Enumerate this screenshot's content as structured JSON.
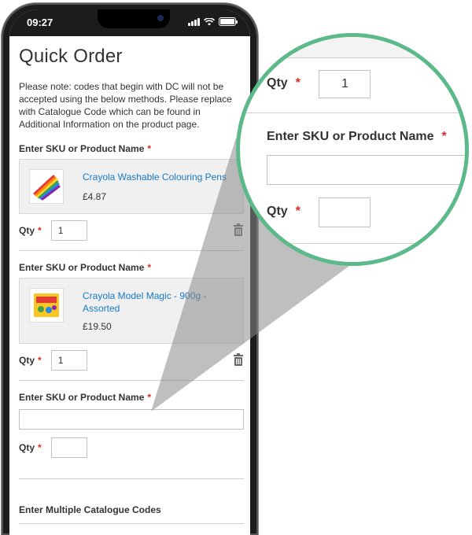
{
  "status_bar": {
    "time": "09:27"
  },
  "page": {
    "title": "Quick Order",
    "note": "Please note: codes that begin with DC will not be accepted using the below methods. Please replace with Catalogue Code which can be found in Additional Information on the product page."
  },
  "rows": [
    {
      "label": "Enter SKU or Product Name",
      "required": "*",
      "product_name": "Crayola Washable Colouring Pens",
      "price": "£4.87",
      "qty_label": "Qty",
      "qty_value": "1"
    },
    {
      "label": "Enter SKU or Product Name",
      "required": "*",
      "product_name": "Crayola Model Magic - 900g - Assorted",
      "price": "£19.50",
      "qty_label": "Qty",
      "qty_value": "1"
    },
    {
      "label": "Enter SKU or Product Name",
      "required": "*",
      "sku_value": "",
      "qty_label": "Qty",
      "qty_value": ""
    }
  ],
  "multiple_codes": {
    "label": "Enter Multiple Catalogue Codes"
  },
  "zoom": {
    "qty_label": "Qty",
    "qty_value": "1",
    "required": "*",
    "sku_label": "Enter SKU or Product Name",
    "sku_value": "",
    "qty2_label": "Qty",
    "qty2_value": ""
  },
  "colors": {
    "accent_green": "#5cb98a",
    "link_blue": "#1979c3",
    "required_red": "#e02b27"
  },
  "icons": [
    "trash-icon",
    "signal-icon",
    "wifi-icon",
    "battery-icon"
  ]
}
